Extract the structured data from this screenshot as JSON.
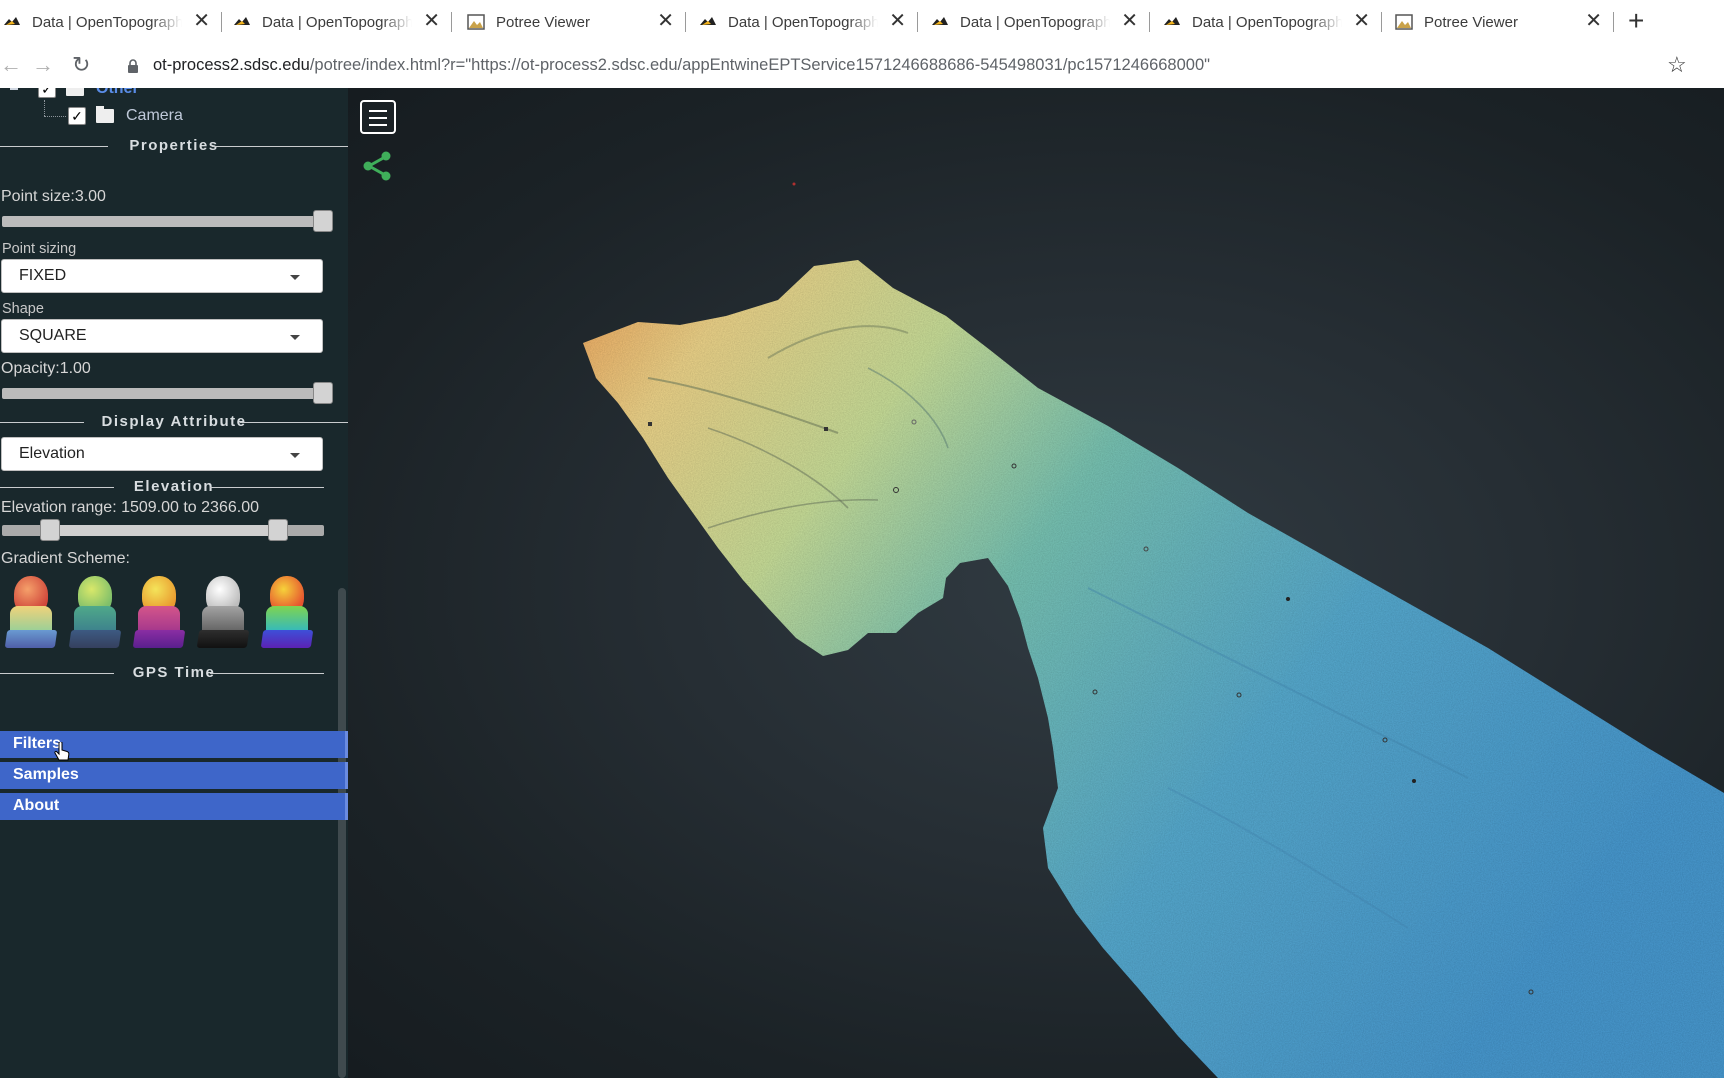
{
  "browser": {
    "tabs": [
      {
        "title": "Data | OpenTopography",
        "icon": "opentopography-favicon-icon"
      },
      {
        "title": "Data | OpenTopography",
        "icon": "opentopography-favicon-icon"
      },
      {
        "title": "Potree Viewer",
        "icon": "potree-favicon-icon"
      },
      {
        "title": "Data | OpenTopography",
        "icon": "opentopography-favicon-icon"
      },
      {
        "title": "Data | OpenTopography",
        "icon": "opentopography-favicon-icon"
      },
      {
        "title": "Data | OpenTopography",
        "icon": "opentopography-favicon-icon"
      },
      {
        "title": "Potree Viewer",
        "icon": "potree-favicon-icon"
      }
    ],
    "close_glyph": "✕",
    "new_tab_glyph": "+",
    "url_host": "ot-process2.sdsc.edu",
    "url_rest": "/potree/index.html?r=\"https://ot-process2.sdsc.edu/appEntwineEPTService1571246688686-545498031/pc1571246668000\""
  },
  "sidebar": {
    "tree": {
      "other_label": "Other",
      "camera_label": "Camera"
    },
    "properties_title": "Properties",
    "point_size_label": "Point size:3.00",
    "point_size_fraction": 1.0,
    "point_sizing_label": "Point sizing",
    "point_sizing_value": "FIXED",
    "shape_label": "Shape",
    "shape_value": "SQUARE",
    "opacity_label": "Opacity:1.00",
    "opacity_fraction": 1.0,
    "display_attribute_title": "Display Attribute",
    "display_attribute_value": "Elevation",
    "elevation_title": "Elevation",
    "elevation_range_label": "Elevation range: 1509.00 to 2366.00",
    "gradient_scheme_label": "Gradient Scheme:",
    "gradient_schemes": [
      "spectral",
      "viridis",
      "plasma",
      "grayscale",
      "rainbow"
    ],
    "gps_time_title": "GPS Time",
    "accordion": [
      "Filters",
      "Samples",
      "About"
    ]
  },
  "colors": {
    "sidebar_bg": "#19282c",
    "accordion_bg": "#3e66c9",
    "share_green": "#3fae5a"
  }
}
